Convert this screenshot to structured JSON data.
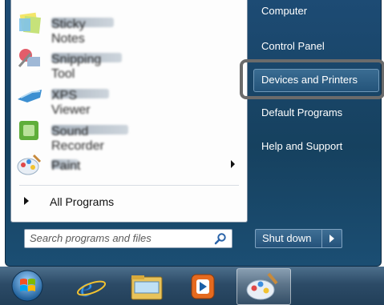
{
  "start_menu": {
    "pinned_programs": [
      {
        "label": "Sticky Notes",
        "icon": "sticky-notes-icon",
        "has_submenu": false
      },
      {
        "label": "Snipping Tool",
        "icon": "snipping-tool-icon",
        "has_submenu": false
      },
      {
        "label": "XPS Viewer",
        "icon": "xps-viewer-icon",
        "has_submenu": false
      },
      {
        "label": "Sound Recorder",
        "icon": "green-app-icon",
        "has_submenu": false
      },
      {
        "label": "Paint",
        "icon": "paint-icon",
        "has_submenu": true
      }
    ],
    "all_programs_label": "All Programs",
    "search": {
      "placeholder": "Search programs and files"
    },
    "right_items": [
      "Computer",
      "Control Panel",
      "Devices and Printers",
      "Default Programs",
      "Help and Support"
    ],
    "highlighted_item": "Devices and Printers",
    "shutdown_label": "Shut down"
  },
  "taskbar": {
    "items": [
      "start-orb-icon",
      "internet-explorer-icon",
      "windows-explorer-icon",
      "media-player-icon",
      "paint-icon"
    ],
    "active_item": "paint-icon"
  },
  "colors": {
    "menu_blue": "#1d4b74",
    "highlight_border": "#6b6b6b"
  }
}
